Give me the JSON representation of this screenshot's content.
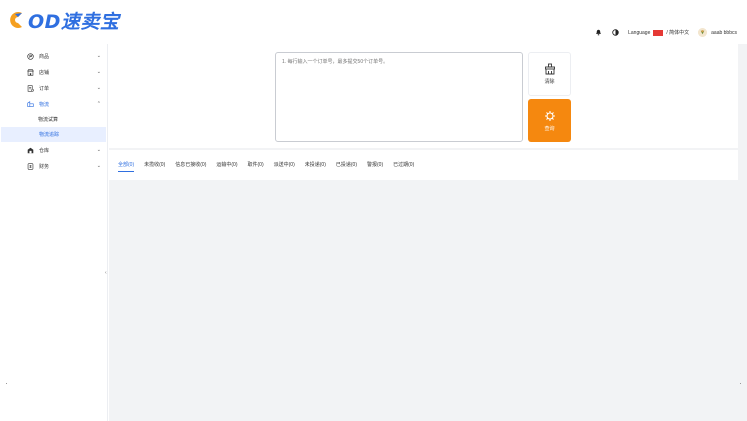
{
  "brand": {
    "logo_text": "OD速卖宝",
    "accent": "#2f6fe0",
    "orange": "#f5880f"
  },
  "header": {
    "icons": [
      "bell-icon",
      "contrast-icon"
    ],
    "language_label": "Language",
    "language_value": "/ 简体中文",
    "username": "aaab bbbcs"
  },
  "sidebar": {
    "items": [
      {
        "label": "商品",
        "icon": "product-icon",
        "expanded": false
      },
      {
        "label": "店铺",
        "icon": "store-icon",
        "expanded": false
      },
      {
        "label": "订单",
        "icon": "order-icon",
        "expanded": false
      },
      {
        "label": "物流",
        "icon": "logistics-icon",
        "expanded": true
      },
      {
        "label": "仓库",
        "icon": "warehouse-icon",
        "expanded": false
      },
      {
        "label": "财务",
        "icon": "finance-icon",
        "expanded": false
      }
    ],
    "logistics_sub": [
      {
        "label": "物流试算",
        "active": false
      },
      {
        "label": "物流追踪",
        "active": true
      }
    ],
    "collapse_glyph": "‹"
  },
  "main": {
    "textarea_placeholder": "1. 每行输入一个订单号，最多提交50个订单号。",
    "clear_label": "清除",
    "query_label": "查询",
    "tabs": [
      {
        "label": "全部(0)",
        "active": true
      },
      {
        "label": "未揽收(0)",
        "active": false
      },
      {
        "label": "信息已接收(0)",
        "active": false
      },
      {
        "label": "运输中(0)",
        "active": false
      },
      {
        "label": "取件(0)",
        "active": false
      },
      {
        "label": "派送中(0)",
        "active": false
      },
      {
        "label": "未投递(0)",
        "active": false
      },
      {
        "label": "已投递(0)",
        "active": false
      },
      {
        "label": "警报(0)",
        "active": false
      },
      {
        "label": "已过期(0)",
        "active": false
      }
    ]
  }
}
